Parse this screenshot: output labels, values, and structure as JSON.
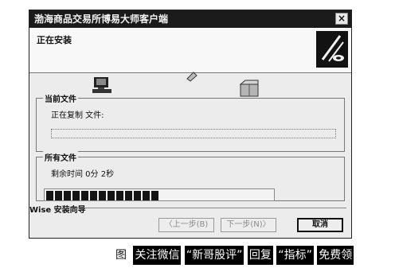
{
  "dialog": {
    "title": "渤海商品交易所博易大师客户端",
    "close_glyph": "×",
    "header_title": "正在安装",
    "current_file": {
      "label": "当前文件",
      "status": "正在复制 文件:"
    },
    "all_files": {
      "label": "所有文件",
      "remaining": "剩余时间 0分 2秒",
      "progress_fraction": 0.53
    },
    "footer": {
      "label": "Wise 安装向导",
      "back": "〈上一步(B)",
      "next": "下一步(N)〉",
      "cancel": "取消"
    }
  },
  "caption": {
    "fig": "图",
    "items": [
      "关注微信",
      "“新哥股评”",
      "回复",
      "“指标”",
      "免费领"
    ]
  },
  "colors": {
    "progress": "#141414",
    "titlebar": "#1b1b1b"
  }
}
